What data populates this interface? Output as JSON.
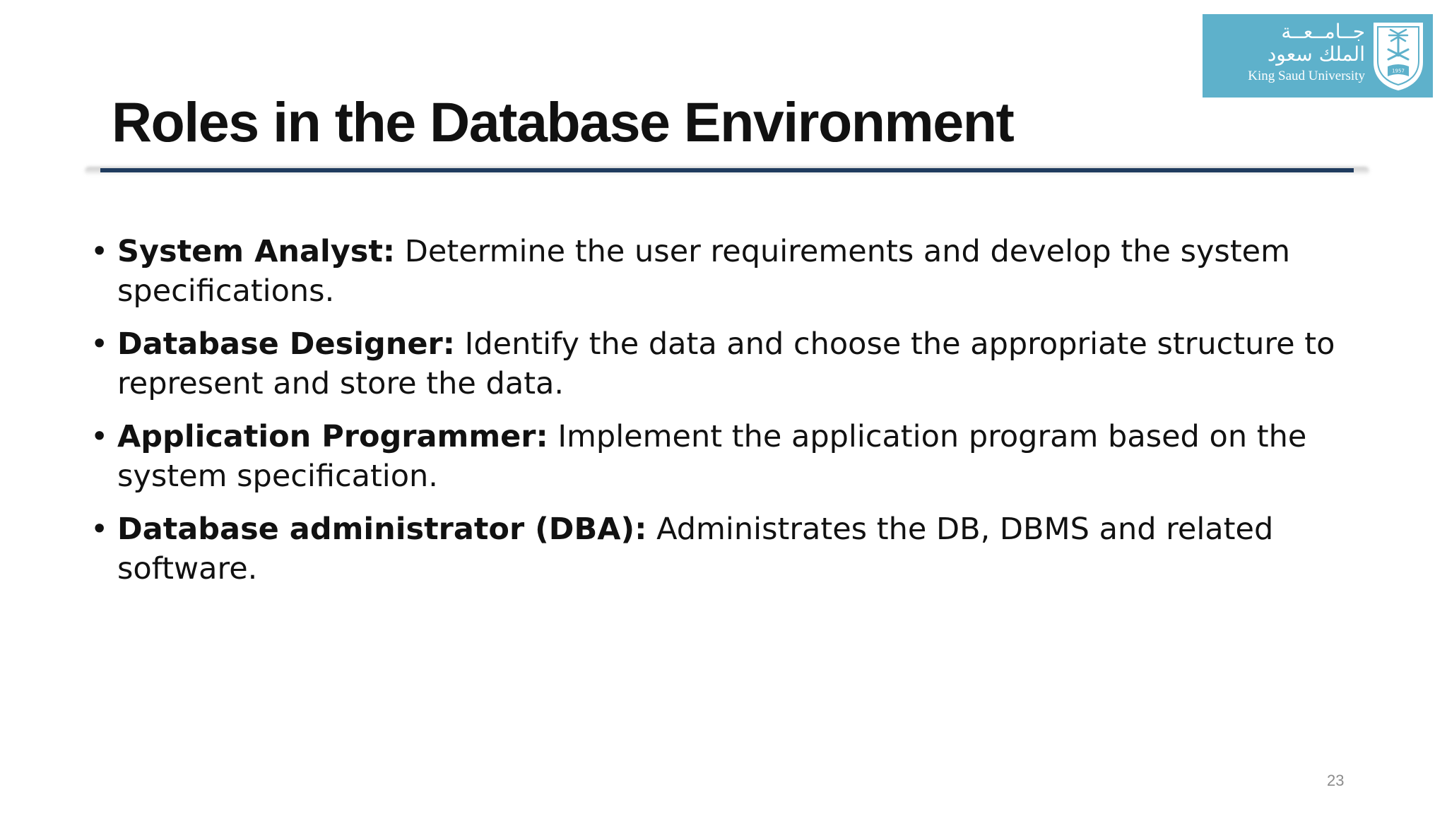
{
  "slide": {
    "title": "Roles in the Database Environment",
    "number": "23"
  },
  "logo": {
    "arabic_line_1": "جــامــعــة",
    "arabic_line_2": "الملك سعود",
    "english": "King Saud University",
    "emblem_year": "1957",
    "background_color": "#5eb1cb"
  },
  "colors": {
    "title_rule": "#1f3b5e",
    "text": "#111111",
    "slide_number": "#8c8c8c"
  },
  "bullets": [
    {
      "term": "System Analyst:",
      "description": " Determine the user requirements and develop the system specifications."
    },
    {
      "term": "Database Designer:",
      "description": " Identify the data and choose the appropriate structure to represent and store the data."
    },
    {
      "term": "Application Programmer:",
      "description": " Implement the application program based on the system specification."
    },
    {
      "term": "Database administrator (DBA):",
      "description": " Administrates the DB, DBMS and related software."
    }
  ]
}
